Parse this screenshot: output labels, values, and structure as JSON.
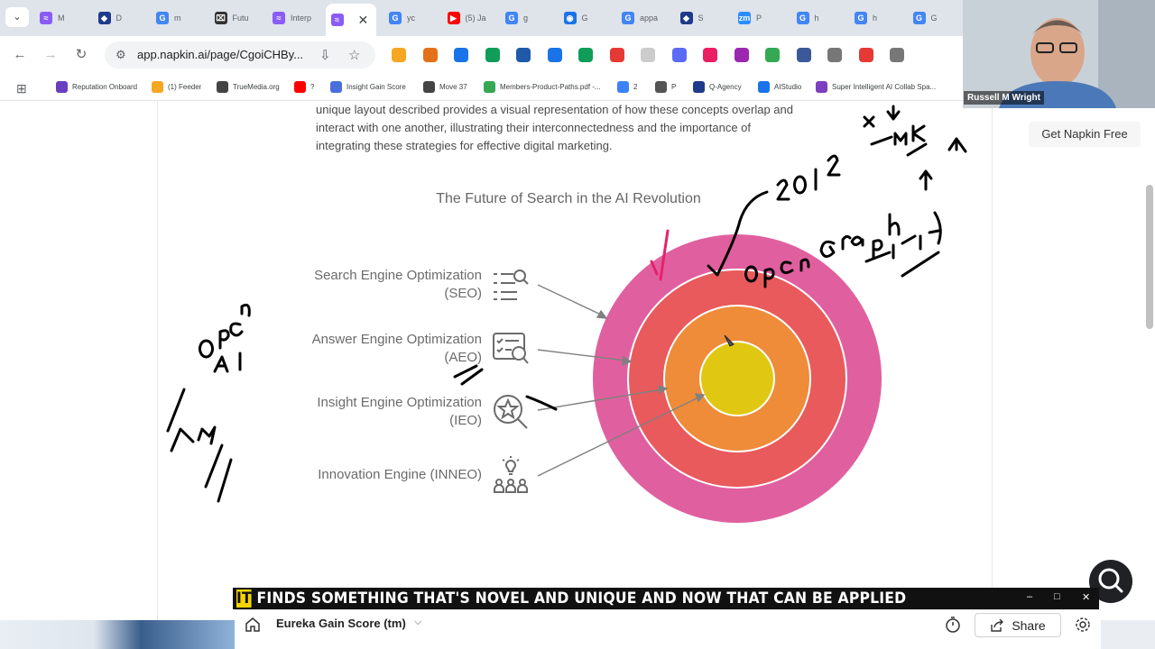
{
  "browser": {
    "tabs": [
      {
        "label": "M",
        "color": "#8a5cf6",
        "glyph": "≈"
      },
      {
        "label": "D",
        "color": "#1e3a8a",
        "glyph": "◆"
      },
      {
        "label": "m",
        "color": "#4285f4",
        "glyph": "G"
      },
      {
        "label": "Futu",
        "color": "#333333",
        "glyph": "⌧"
      },
      {
        "label": "Interp",
        "color": "#8a5cf6",
        "glyph": "≈"
      },
      {
        "label": "",
        "color": "#8a5cf6",
        "glyph": "≈",
        "active": true
      },
      {
        "label": "yc",
        "color": "#4285f4",
        "glyph": "G"
      },
      {
        "label": "(5) Ja",
        "color": "#ff0000",
        "glyph": "▶"
      },
      {
        "label": "g",
        "color": "#4285f4",
        "glyph": "G"
      },
      {
        "label": "G",
        "color": "#1a73e8",
        "glyph": "◉"
      },
      {
        "label": "appa",
        "color": "#4285f4",
        "glyph": "G"
      },
      {
        "label": "S",
        "color": "#1e3a8a",
        "glyph": "◆"
      },
      {
        "label": "P",
        "color": "#2d8cff",
        "glyph": "zm"
      },
      {
        "label": "h",
        "color": "#4285f4",
        "glyph": "G"
      },
      {
        "label": "h",
        "color": "#4285f4",
        "glyph": "G"
      },
      {
        "label": "G",
        "color": "#4285f4",
        "glyph": "G"
      }
    ],
    "url": "app.napkin.ai/page/CgoiCHBy...",
    "bookmarks": [
      {
        "label": "Reputation Onboard",
        "color": "#6a3fbf"
      },
      {
        "label": "(1) Feeder",
        "color": "#f5a623"
      },
      {
        "label": "TrueMedia.org",
        "color": "#444444"
      },
      {
        "label": "?",
        "color": "#ff0000"
      },
      {
        "label": "Insight Gain Score",
        "color": "#4a6fdc"
      },
      {
        "label": "Move 37",
        "color": "#444444"
      },
      {
        "label": "Members-Product-Paths.pdf -...",
        "color": "#34a853"
      },
      {
        "label": "2",
        "color": "#3b82f6"
      },
      {
        "label": "P",
        "color": "#555555"
      },
      {
        "label": "Q-Agency",
        "color": "#1e3a8a"
      },
      {
        "label": "AIStudio",
        "color": "#1a73e8"
      },
      {
        "label": "Super Intelligent AI Collab Spa...",
        "color": "#7e3fbf"
      }
    ]
  },
  "page": {
    "intro_lines": [
      "unique layout described provides a visual representation of how these concepts overlap and",
      "interact with one another, illustrating their interconnectedness and the importance of",
      "integrating these strategies for effective digital marketing."
    ],
    "diagram_title": "The Future of Search in the AI Revolution",
    "rows": [
      {
        "label_line1": "Search Engine Optimization",
        "label_line2": "(SEO)",
        "icon": "list-search-icon"
      },
      {
        "label_line1": "Answer Engine Optimization",
        "label_line2": "(AEO)",
        "icon": "checklist-search-icon"
      },
      {
        "label_line1": "Insight Engine Optimization",
        "label_line2": "(IEO)",
        "icon": "star-search-icon"
      },
      {
        "label_line1": "Innovation Engine (INNEO)",
        "label_line2": "",
        "icon": "lightbulb-people-icon"
      }
    ],
    "rings": {
      "colors": [
        "#e0609f",
        "#e95a5c",
        "#ee8c3a",
        "#e0c812"
      ]
    },
    "side_button": "Get Napkin Free"
  },
  "webcam": {
    "name": "Russell M Wright"
  },
  "caption": {
    "highlight": "IT",
    "rest": " FINDS SOMETHING THAT'S NOVEL AND UNIQUE AND NOW THAT CAN BE APPLIED"
  },
  "bottom_bar": {
    "title": "Eureka Gain Score (tm)",
    "share_label": "Share"
  }
}
